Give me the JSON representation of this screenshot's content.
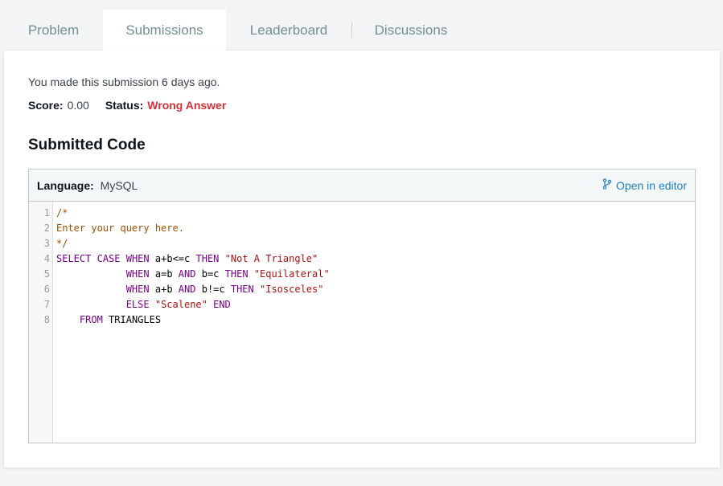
{
  "tabs": [
    {
      "label": "Problem",
      "active": false
    },
    {
      "label": "Submissions",
      "active": true
    },
    {
      "label": "Leaderboard",
      "active": false
    },
    {
      "label": "Discussions",
      "active": false
    }
  ],
  "submission": {
    "meta": "You made this submission 6 days ago.",
    "score_label": "Score:",
    "score_value": "0.00",
    "status_label": "Status:",
    "status_value": "Wrong Answer",
    "status_color": "#d3303b"
  },
  "section_title": "Submitted Code",
  "code_panel": {
    "language_label": "Language:",
    "language_value": "MySQL",
    "open_editor_label": "Open in editor",
    "open_editor_icon": "git-branch-icon",
    "line_numbers": [
      "1",
      "2",
      "3",
      "4",
      "5",
      "6",
      "7",
      "8"
    ],
    "lines": [
      "/*",
      "Enter your query here.",
      "*/",
      "SELECT CASE WHEN a+b<=c THEN \"Not A Triangle\"",
      "            WHEN a=b AND b=c THEN \"Equilateral\"",
      "            WHEN a+b AND b!=c THEN \"Isosceles\"",
      "            ELSE \"Scalene\" END",
      "    FROM TRIANGLES"
    ]
  },
  "colors": {
    "accent_link": "#1f7fc1",
    "error": "#d3303b",
    "code_keyword": "#770088",
    "code_string": "#aa1111",
    "code_comment": "#a05000"
  }
}
